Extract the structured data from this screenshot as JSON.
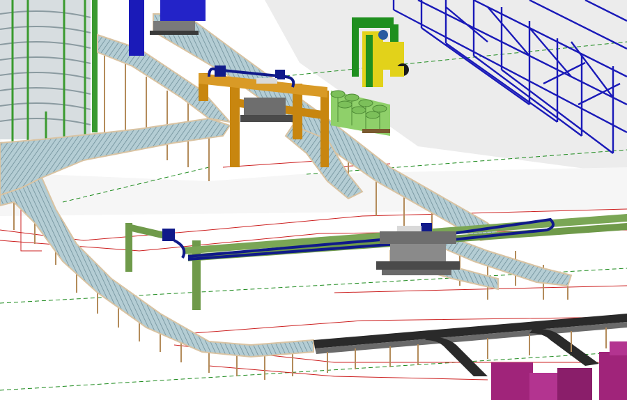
{
  "scene": {
    "colors": {
      "background": "#ffffff",
      "floor_shadow": "#e9e9e9",
      "floor_grid_red": "#cc1f1f",
      "floor_grid_green_dashed": "#1c8a1c",
      "rack_blue": "#1a1ab8",
      "conveyor_belt": "#a8c4cc",
      "conveyor_stripe": "#6f8f99",
      "conveyor_rail": "#d9c3a2",
      "conveyor_leg": "#b38b5a",
      "gantry_orange": "#c8860f",
      "gantry_green": "#6f9a4a",
      "spiral_green": "#3a9a2f",
      "forklift_green": "#1f8f1f",
      "forklift_yellow": "#e2d21a",
      "barrels_green": "#8fd06a",
      "machine_magenta": "#a0247a",
      "dark_conveyor": "#2a2a2a",
      "track_navy": "#101a8a",
      "metal_grey": "#7a7a7a"
    },
    "objects": [
      "spiral-conveyor",
      "pallet-rack",
      "forklift",
      "barrel-pallet",
      "gantry-robot-orange",
      "gantry-robot-green",
      "roller-conveyor",
      "belt-conveyor",
      "wrapping-machine"
    ]
  }
}
